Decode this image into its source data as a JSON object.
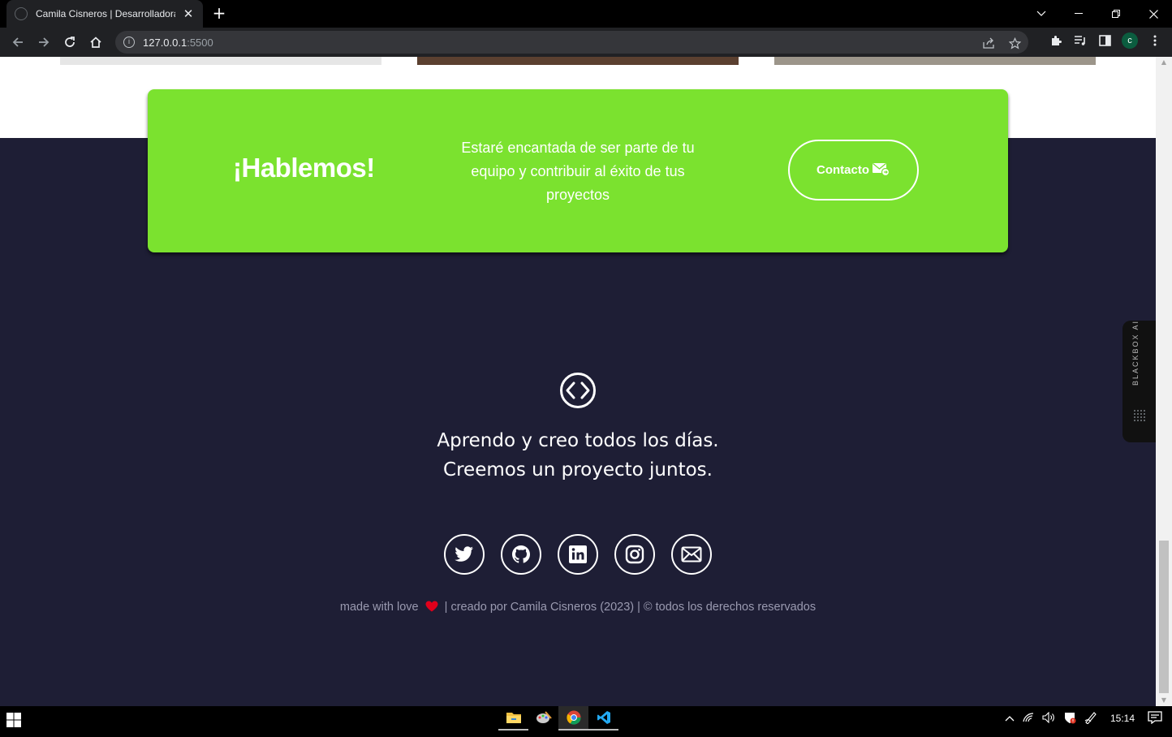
{
  "browser": {
    "tab_title": "Camila Cisneros | Desarrolladora",
    "tab_close": "✕",
    "new_tab": "+",
    "url_host": "127.0.0.1",
    "url_port": ":5500",
    "profile_initial": "c"
  },
  "cta": {
    "title": "¡Hablemos!",
    "text": "Estaré encantada de ser parte de tu equipo y contribuir al éxito de tus proyectos",
    "button_label": "Contacto"
  },
  "footer": {
    "tagline_line1": "Aprendo y creo todos los días.",
    "tagline_line2": "Creemos un proyecto juntos.",
    "social_icons": [
      "twitter-icon",
      "github-icon",
      "linkedin-icon",
      "instagram-icon",
      "mail-icon"
    ],
    "credit_prefix": "made with love",
    "credit_suffix": "| creado por Camila Cisneros (2023) | © todos los derechos reservados"
  },
  "extension": {
    "label": "BLACKBOX AI"
  },
  "taskbar": {
    "time": "15:14"
  },
  "colors": {
    "accent_green": "#7be22f",
    "footer_bg": "#1e1e35",
    "heart": "#e0001b"
  }
}
